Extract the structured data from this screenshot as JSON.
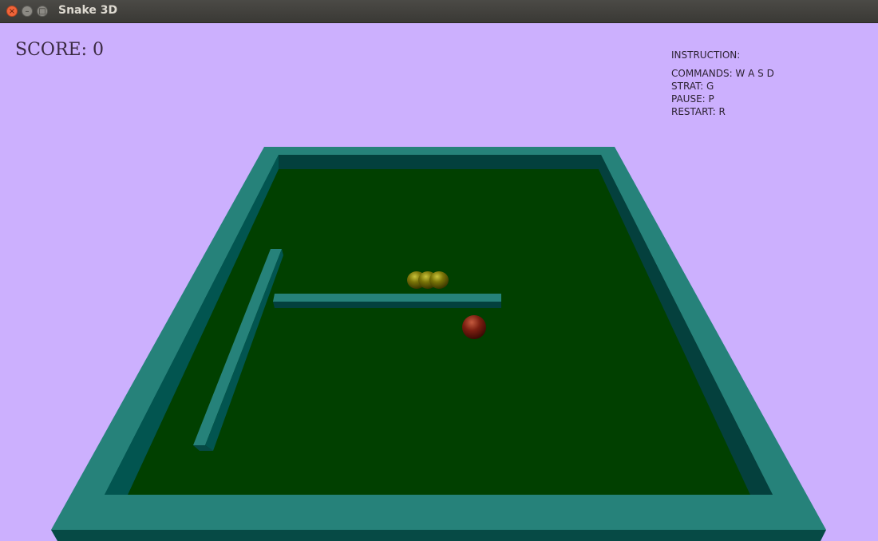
{
  "window": {
    "title": "Snake 3D",
    "close_glyph": "×",
    "minimize_glyph": "–",
    "maximize_glyph": "□"
  },
  "hud": {
    "score_label": "SCORE: 0",
    "instructions": {
      "title": "INSTRUCTION:",
      "commands": "COMMANDS: W A S D",
      "start": "STRAT: G",
      "pause": "PAUSE: P",
      "restart": "RESTART: R"
    }
  },
  "colors": {
    "background": "#ccb0fe",
    "board_floor": "#014000",
    "wall_top": "#26827a",
    "wall_shadow": "#03403d",
    "snake": "#6b6a06",
    "food": "#7a1e10"
  }
}
